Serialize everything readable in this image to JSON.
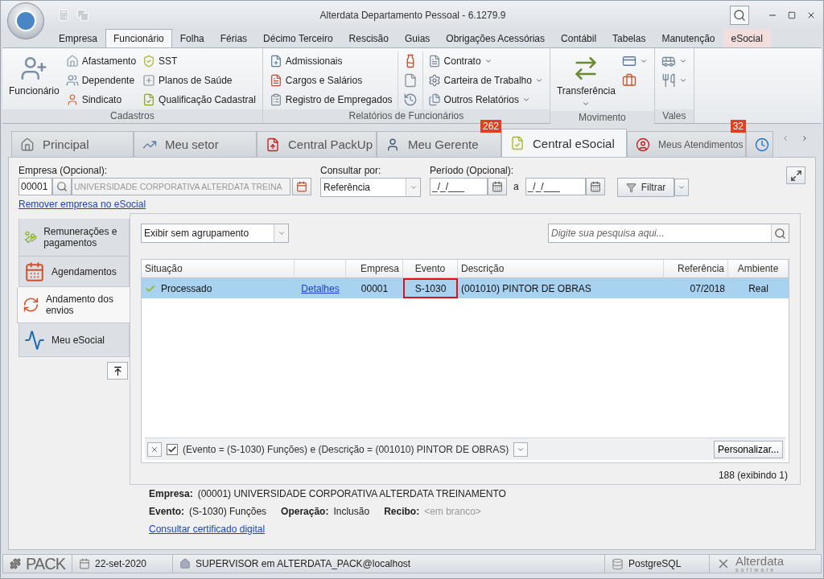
{
  "window": {
    "title": "Alterdata Departamento Pessoal - 6.1279.9"
  },
  "ribbon_tabs": [
    {
      "label": "Empresa",
      "selected": false,
      "contextual": false
    },
    {
      "label": "Funcionário",
      "selected": true,
      "contextual": false
    },
    {
      "label": "Folha",
      "selected": false,
      "contextual": false
    },
    {
      "label": "Férias",
      "selected": false,
      "contextual": false
    },
    {
      "label": "Décimo Terceiro",
      "selected": false,
      "contextual": false
    },
    {
      "label": "Rescisão",
      "selected": false,
      "contextual": false
    },
    {
      "label": "Guias",
      "selected": false,
      "contextual": false
    },
    {
      "label": "Obrigações Acessórias",
      "selected": false,
      "contextual": false
    },
    {
      "label": "Contábil",
      "selected": false,
      "contextual": false
    },
    {
      "label": "Tabelas",
      "selected": false,
      "contextual": false
    },
    {
      "label": "Manutenção",
      "selected": false,
      "contextual": false
    },
    {
      "label": "eSocial",
      "selected": false,
      "contextual": true
    }
  ],
  "ribbon_groups": [
    {
      "title": "Cadastros",
      "columns": [
        [
          {
            "kind": "large",
            "label": "Funcionário",
            "dropdown": false
          }
        ],
        [
          {
            "kind": "small",
            "label": "Afastamento",
            "dropdown": false
          },
          {
            "kind": "small",
            "label": "Dependente",
            "dropdown": false
          },
          {
            "kind": "small",
            "label": "Sindicato",
            "dropdown": false
          }
        ],
        [
          {
            "kind": "small",
            "label": "SST",
            "dropdown": false
          },
          {
            "kind": "small",
            "label": "Planos de Saúde",
            "dropdown": false
          },
          {
            "kind": "small",
            "label": "Qualificação Cadastral",
            "dropdown": false
          }
        ]
      ]
    },
    {
      "title": "Relatórios de Funcionários",
      "columns": [
        [
          {
            "kind": "small",
            "label": "Admissionais",
            "dropdown": false
          },
          {
            "kind": "small",
            "label": "Cargos e Salários",
            "dropdown": false
          },
          {
            "kind": "small",
            "label": "Registro de Empregados",
            "dropdown": false
          }
        ],
        [
          {
            "kind": "icon",
            "dropdown": false
          },
          {
            "kind": "icon",
            "dropdown": false
          },
          {
            "kind": "icon",
            "dropdown": false
          }
        ],
        [
          {
            "kind": "small",
            "label": "Contrato",
            "dropdown": true
          },
          {
            "kind": "small",
            "label": "Carteira de Trabalho",
            "dropdown": true
          },
          {
            "kind": "small",
            "label": "Outros Relatórios",
            "dropdown": true
          }
        ]
      ]
    },
    {
      "title": "Movimento",
      "columns": [
        [
          {
            "kind": "large",
            "label": "Transferência",
            "dropdown": true
          }
        ],
        [
          {
            "kind": "icon",
            "dropdown": true
          },
          {
            "kind": "icon",
            "dropdown": false
          }
        ]
      ]
    },
    {
      "title": "Vales",
      "columns": [
        [
          {
            "kind": "icon",
            "dropdown": true
          },
          {
            "kind": "icon",
            "dropdown": true
          }
        ]
      ]
    }
  ],
  "doc_tabs": [
    {
      "label": "Principal",
      "selected": false,
      "small": false
    },
    {
      "label": "Meu setor",
      "selected": false,
      "small": false
    },
    {
      "label": "Central PackUp",
      "selected": false,
      "small": false
    },
    {
      "label": "Meu Gerente",
      "selected": false,
      "badge": "262",
      "small": false
    },
    {
      "label": "Central eSocial",
      "selected": true,
      "small": false
    },
    {
      "label": "Meus Atendimentos",
      "selected": false,
      "badge": "32",
      "small": true
    },
    {
      "selected": false
    }
  ],
  "filters": {
    "empresa": {
      "label": "Empresa (Opcional):",
      "code": "00001",
      "name": "UNIVERSIDADE CORPORATIVA ALTERDATA TREINA",
      "link": "Remover empresa no eSocial"
    },
    "consultar": {
      "label": "Consultar por:",
      "value": "Referência"
    },
    "periodo": {
      "label": "Período (Opcional):",
      "from": "_/_/___",
      "separator": "a",
      "to": "_/_/___"
    },
    "button": "Filtrar"
  },
  "side_nav": [
    {
      "label": "Remunerações e pagamentos",
      "selected": false
    },
    {
      "label": "Agendamentos",
      "selected": false
    },
    {
      "label": "Andamento dos envios",
      "selected": true
    },
    {
      "label": "Meu eSocial",
      "selected": false
    }
  ],
  "grouping": {
    "value": "Exibir sem agrupamento"
  },
  "search": {
    "placeholder": "Digite sua pesquisa aqui..."
  },
  "table": {
    "columns": [
      {
        "label": "Situação"
      },
      {},
      {
        "label": "Empresa"
      },
      {
        "label": "Evento"
      },
      {
        "label": "Descrição"
      },
      {
        "label": "Referência"
      },
      {
        "label": "Ambiente"
      }
    ],
    "rows": [
      {
        "selected": true,
        "situacao": "Processado",
        "detalhes": "Detalhes",
        "empresa": "00001",
        "evento": "S-1030",
        "evento_highlighted": true,
        "descricao": "(001010) PINTOR DE OBRAS",
        "referencia": "07/2018",
        "ambiente": "Real"
      }
    ]
  },
  "filter_bar": {
    "enabled": true,
    "text": "(Evento = (S-1030) Funções) e (Descrição = (001010) PINTOR DE OBRAS)",
    "button": "Personalizar..."
  },
  "count": "188 (exibindo 1)",
  "details": {
    "empresa": {
      "label": "Empresa:",
      "value": "(00001) UNIVERSIDADE CORPORATIVA ALTERDATA TREINAMENTO"
    },
    "fields": [
      {
        "label": "Evento:",
        "value": "(S-1030) Funções",
        "empty": false
      },
      {
        "label": "Operação:",
        "value": "Inclusão",
        "empty": false
      },
      {
        "label": "Recibo:",
        "value": "<em branco>",
        "empty": true
      }
    ],
    "link": "Consultar certificado digital"
  },
  "status_bar": {
    "logo": "PACK",
    "date": "22-set-2020",
    "user": "SUPERVISOR em ALTERDATA_PACK@localhost",
    "database": "PostgreSQL",
    "brand": "Alterdata",
    "brand_sub": "software"
  }
}
